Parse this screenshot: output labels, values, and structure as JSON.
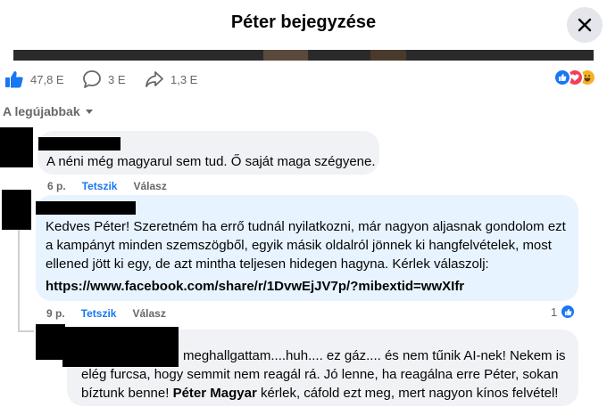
{
  "header": {
    "title": "Péter bejegyzése"
  },
  "stats": {
    "likes": "47,8 E",
    "comments": "3 E",
    "shares": "1,3 E"
  },
  "sort_label": "A legújabbak",
  "comments": [
    {
      "text": "A néni még magyarul sem tud. Ő saját maga szégyene.",
      "time": "6 p.",
      "like": "Tetszik",
      "reply": "Válasz"
    },
    {
      "lines": [
        "Kedves Péter! Szeretném ha errő tudnál nyilatkozni, már nagyon aljasnak gondolom ezt",
        "a kampányt minden szemszögből, egyik másik oldalról jönnek ki hangfelvételek, most",
        "ellened jött ki egy, de azt mintha teljesen hidegen hagyna. Kérlek válaszolj:"
      ],
      "link": "https://www.facebook.com/share/r/1DvwEjJV7p/?mibextid=wwXIfr",
      "time": "9 p.",
      "like": "Tetszik",
      "reply": "Válasz",
      "reaction_count": "1"
    },
    {
      "line1": "meghallgattam....huh.... ez gáz.... és nem tűnik AI-nek! Nekem is",
      "line2": "elég furcsa, hogy semmit nem reagál rá. Jó lenne, ha reagálna erre Péter, sokan",
      "line3_pre": "bíztunk benne! ",
      "line3_name": "Péter Magyar",
      "line3_post": " kérlek, cáfold ezt meg, mert nagyon kínos felvétel!"
    }
  ],
  "colors": {
    "accent": "#1877f2",
    "bubble": "#f0f2f5",
    "bubble_highlight": "#e7f3ff",
    "muted": "#65676b"
  }
}
